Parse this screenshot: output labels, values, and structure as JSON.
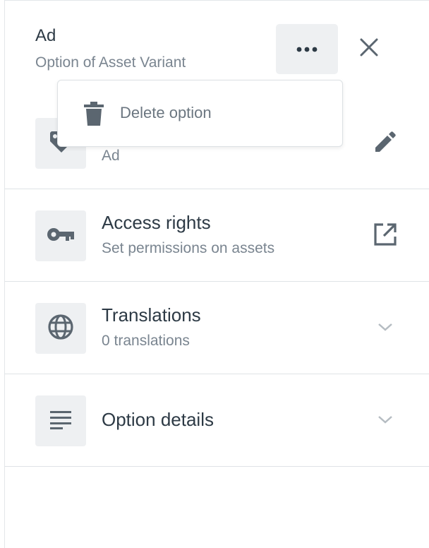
{
  "header": {
    "title": "Ad",
    "subtitle": "Option of Asset Variant"
  },
  "menu": {
    "items": [
      {
        "label": "Delete option",
        "icon": "trash-icon"
      }
    ]
  },
  "rows": [
    {
      "title": "",
      "subtitle": "Ad",
      "icon": "tag-icon",
      "action_icon": "pencil-icon"
    },
    {
      "title": "Access rights",
      "subtitle": "Set permissions on assets",
      "icon": "key-icon",
      "action_icon": "external-link-icon"
    },
    {
      "title": "Translations",
      "subtitle": "0 translations",
      "icon": "globe-icon",
      "action_icon": "chevron-down-icon"
    },
    {
      "title": "Option details",
      "subtitle": "",
      "icon": "text-lines-icon",
      "action_icon": "chevron-down-icon"
    }
  ],
  "colors": {
    "text": "#2d3a45",
    "muted": "#7a8590",
    "icon": "#5b6670",
    "tile_bg": "#eef0f2",
    "divider": "#dfe3e6"
  }
}
